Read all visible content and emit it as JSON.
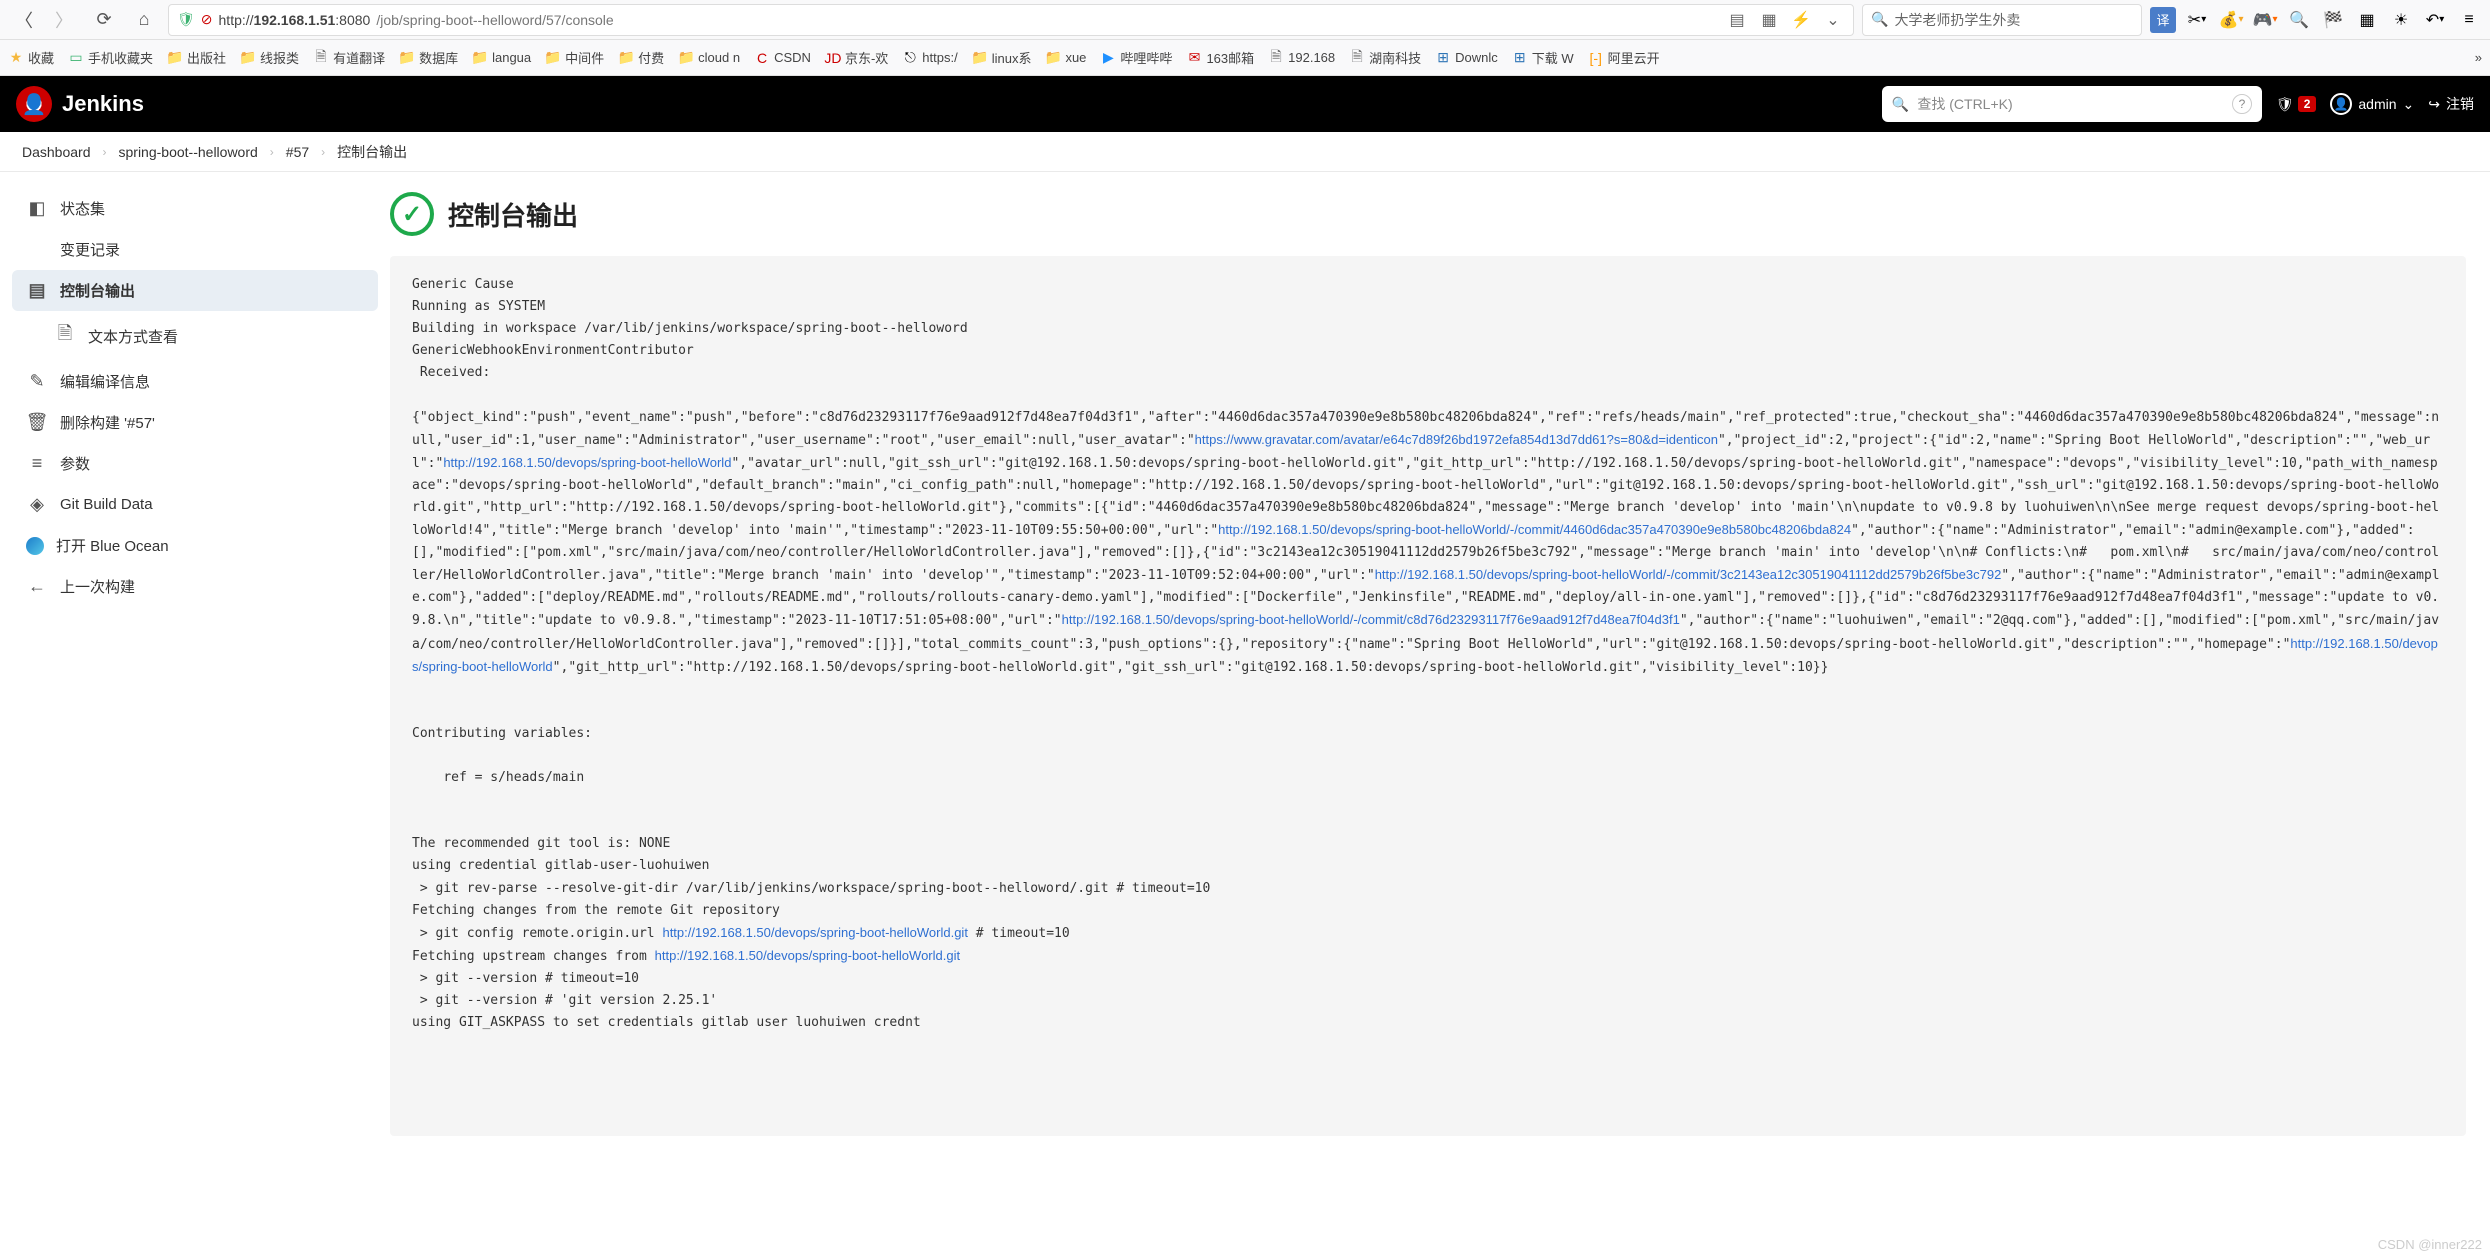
{
  "browser": {
    "url_host": "192.168.1.51",
    "url_port": ":8080",
    "url_path": "/job/spring-boot--helloword/57/console",
    "search_placeholder": "大学老师扔学生外卖"
  },
  "bookmarks": [
    {
      "ic": "★",
      "cl": "#f5b83d",
      "label": "收藏"
    },
    {
      "ic": "▭",
      "cl": "#3cb371",
      "label": "手机收藏夹"
    },
    {
      "ic": "📁",
      "cl": "#f5b83d",
      "label": "出版社"
    },
    {
      "ic": "📁",
      "cl": "#f5b83d",
      "label": "线报类"
    },
    {
      "ic": "🗎",
      "cl": "#666",
      "label": "有道翻译"
    },
    {
      "ic": "📁",
      "cl": "#f5b83d",
      "label": "数据库"
    },
    {
      "ic": "📁",
      "cl": "#f5b83d",
      "label": "langua"
    },
    {
      "ic": "📁",
      "cl": "#f5b83d",
      "label": "中间件"
    },
    {
      "ic": "📁",
      "cl": "#f5b83d",
      "label": "付费"
    },
    {
      "ic": "📁",
      "cl": "#f5b83d",
      "label": "cloud n"
    },
    {
      "ic": "C",
      "cl": "#c00",
      "label": "CSDN"
    },
    {
      "ic": "JD",
      "cl": "#c00",
      "label": "京东-欢"
    },
    {
      "ic": "⎋",
      "cl": "#000",
      "label": "https:/"
    },
    {
      "ic": "📁",
      "cl": "#f5b83d",
      "label": "linux系"
    },
    {
      "ic": "📁",
      "cl": "#f5b83d",
      "label": "xue"
    },
    {
      "ic": "▶",
      "cl": "#1e90ff",
      "label": "哔哩哔哔"
    },
    {
      "ic": "✉",
      "cl": "#c00",
      "label": "163邮箱"
    },
    {
      "ic": "🗎",
      "cl": "#666",
      "label": "192.168"
    },
    {
      "ic": "🗎",
      "cl": "#666",
      "label": "湖南科技"
    },
    {
      "ic": "⊞",
      "cl": "#2e75b6",
      "label": "Downlc"
    },
    {
      "ic": "⊞",
      "cl": "#2e75b6",
      "label": "下载 W"
    },
    {
      "ic": "[-]",
      "cl": "#ff9900",
      "label": "阿里云开"
    }
  ],
  "header": {
    "brand": "Jenkins",
    "search_placeholder": "查找 (CTRL+K)",
    "warn_count": "2",
    "user": "admin",
    "logout": "注销"
  },
  "crumbs": [
    "Dashboard",
    "spring-boot--helloword",
    "#57",
    "控制台输出"
  ],
  "sidebar": {
    "items": [
      {
        "ic": "◧",
        "label": "状态集"
      },
      {
        "ic": "</>",
        "label": "变更记录"
      },
      {
        "ic": "▤",
        "label": "控制台输出",
        "active": true
      },
      {
        "ic": "🗎",
        "label": "文本方式查看",
        "sub": true
      },
      {
        "ic": "✎",
        "label": "编辑编译信息"
      },
      {
        "ic": "🗑",
        "label": "删除构建 '#57'"
      },
      {
        "ic": "≡",
        "label": "参数"
      },
      {
        "ic": "◈",
        "label": "Git Build Data"
      },
      {
        "ic": "BO",
        "label": "打开 Blue Ocean"
      },
      {
        "ic": "←",
        "label": "上一次构建"
      }
    ]
  },
  "page": {
    "title": "控制台输出"
  },
  "console": {
    "l1": "Generic Cause",
    "l2": "Running as SYSTEM",
    "l3": "Building in workspace /var/lib/jenkins/workspace/spring-boot--helloword",
    "l4": "GenericWebhookEnvironmentContributor",
    "l5": " Received:",
    "json_a": "{\"object_kind\":\"push\",\"event_name\":\"push\",\"before\":\"c8d76d23293117f76e9aad912f7d48ea7f04d3f1\",\"after\":\"4460d6dac357a470390e9e8b580bc48206bda824\",\"ref\":\"refs/heads/main\",\"ref_protected\":true,\"checkout_sha\":\"4460d6dac357a470390e9e8b580bc48206bda824\",\"message\":null,\"user_id\":1,\"user_name\":\"Administrator\",\"user_username\":\"root\",\"user_email\":null,\"user_avatar\":\"",
    "link1": "https://www.gravatar.com/avatar/e64c7d89f26bd1972efa854d13d7dd61?s=80&d=identicon",
    "json_b": "\",\"project_id\":2,\"project\":{\"id\":2,\"name\":\"Spring Boot HelloWorld\",\"description\":\"\",\"web_url\":\"",
    "link2": "http://192.168.1.50/devops/spring-boot-helloWorld",
    "json_c": "\",\"avatar_url\":null,\"git_ssh_url\":\"git@192.168.1.50:devops/spring-boot-helloWorld.git\",\"git_http_url\":\"http://192.168.1.50/devops/spring-boot-helloWorld.git\",\"namespace\":\"devops\",\"visibility_level\":10,\"path_with_namespace\":\"devops/spring-boot-helloWorld\",\"default_branch\":\"main\",\"ci_config_path\":null,\"homepage\":\"http://192.168.1.50/devops/spring-boot-helloWorld\",\"url\":\"git@192.168.1.50:devops/spring-boot-helloWorld.git\",\"ssh_url\":\"git@192.168.1.50:devops/spring-boot-helloWorld.git\",\"http_url\":\"http://192.168.1.50/devops/spring-boot-helloWorld.git\"},\"commits\":[{\"id\":\"4460d6dac357a470390e9e8b580bc48206bda824\",\"message\":\"Merge branch 'develop' into 'main'\\n\\nupdate to v0.9.8 by luohuiwen\\n\\nSee merge request devops/spring-boot-helloWorld!4\",\"title\":\"Merge branch 'develop' into 'main'\",\"timestamp\":\"2023-11-10T09:55:50+00:00\",\"url\":\"",
    "link3": "http://192.168.1.50/devops/spring-boot-helloWorld/-/commit/4460d6dac357a470390e9e8b580bc48206bda824",
    "json_d": "\",\"author\":{\"name\":\"Administrator\",\"email\":\"admin@example.com\"},\"added\":[],\"modified\":[\"pom.xml\",\"src/main/java/com/neo/controller/HelloWorldController.java\"],\"removed\":[]},{\"id\":\"3c2143ea12c30519041112dd2579b26f5be3c792\",\"message\":\"Merge branch 'main' into 'develop'\\n\\n# Conflicts:\\n#   pom.xml\\n#   src/main/java/com/neo/controller/HelloWorldController.java\",\"title\":\"Merge branch 'main' into 'develop'\",\"timestamp\":\"2023-11-10T09:52:04+00:00\",\"url\":\"",
    "link4": "http://192.168.1.50/devops/spring-boot-helloWorld/-/commit/3c2143ea12c30519041112dd2579b26f5be3c792",
    "json_e": "\",\"author\":{\"name\":\"Administrator\",\"email\":\"admin@example.com\"},\"added\":[\"deploy/README.md\",\"rollouts/README.md\",\"rollouts/rollouts-canary-demo.yaml\"],\"modified\":[\"Dockerfile\",\"Jenkinsfile\",\"README.md\",\"deploy/all-in-one.yaml\"],\"removed\":[]},{\"id\":\"c8d76d23293117f76e9aad912f7d48ea7f04d3f1\",\"message\":\"update to v0.9.8.\\n\",\"title\":\"update to v0.9.8.\",\"timestamp\":\"2023-11-10T17:51:05+08:00\",\"url\":\"",
    "link5": "http://192.168.1.50/devops/spring-boot-helloWorld/-/commit/c8d76d23293117f76e9aad912f7d48ea7f04d3f1",
    "json_f": "\",\"author\":{\"name\":\"luohuiwen\",\"email\":\"2@qq.com\"},\"added\":[],\"modified\":[\"pom.xml\",\"src/main/java/com/neo/controller/HelloWorldController.java\"],\"removed\":[]}],\"total_commits_count\":3,\"push_options\":{},\"repository\":{\"name\":\"Spring Boot HelloWorld\",\"url\":\"git@192.168.1.50:devops/spring-boot-helloWorld.git\",\"description\":\"\",\"homepage\":\"",
    "link6": "http://192.168.1.50/devops/spring-boot-helloWorld",
    "json_g": "\",\"git_http_url\":\"http://192.168.1.50/devops/spring-boot-helloWorld.git\",\"git_ssh_url\":\"git@192.168.1.50:devops/spring-boot-helloWorld.git\",\"visibility_level\":10}}",
    "l6": "Contributing variables:",
    "l7": "    ref = s/heads/main",
    "l8": "The recommended git tool is: NONE",
    "l9": "using credential gitlab-user-luohuiwen",
    "l10": " > git rev-parse --resolve-git-dir /var/lib/jenkins/workspace/spring-boot--helloword/.git # timeout=10",
    "l11": "Fetching changes from the remote Git repository",
    "l12a": " > git config remote.origin.url ",
    "link7": "http://192.168.1.50/devops/spring-boot-helloWorld.git",
    "l12b": " # timeout=10",
    "l13a": "Fetching upstream changes from ",
    "link8": "http://192.168.1.50/devops/spring-boot-helloWorld.git",
    "l14": " > git --version # timeout=10",
    "l15": " > git --version # 'git version 2.25.1'",
    "l16": "using GIT_ASKPASS to set credentials gitlab user luohuiwen crednt"
  },
  "watermark": "CSDN @inner222"
}
